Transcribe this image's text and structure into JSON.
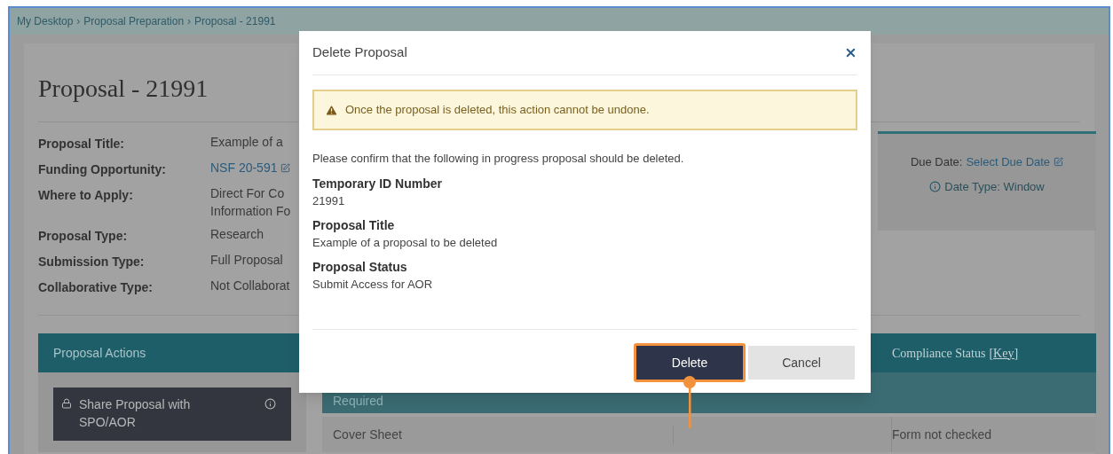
{
  "breadcrumb": {
    "separator": "›",
    "items": [
      "My Desktop",
      "Proposal Preparation",
      "Proposal - 21991"
    ]
  },
  "page_title": "Proposal - 21991",
  "details": [
    {
      "label": "Proposal Title:",
      "lines": [
        "Example of a"
      ],
      "kind": "text"
    },
    {
      "label": "Funding Opportunity:",
      "lines": [
        "NSF 20-591"
      ],
      "kind": "link"
    },
    {
      "label": "Where to Apply:",
      "lines": [
        "Direct For Co",
        "Information Fo"
      ],
      "kind": "text"
    },
    {
      "label": "Proposal Type:",
      "lines": [
        "Research"
      ],
      "kind": "text"
    },
    {
      "label": "Submission Type:",
      "lines": [
        "Full Proposal"
      ],
      "kind": "text"
    },
    {
      "label": "Collaborative Type:",
      "lines": [
        "Not Collaborat"
      ],
      "kind": "text"
    }
  ],
  "due_date": {
    "label": "Due Date:",
    "link": "Select Due Date",
    "date_type": "Date Type: Window"
  },
  "actions": {
    "title": "Proposal Actions",
    "buttons": [
      {
        "label": "Share Proposal with SPO/AOR",
        "locked": true
      }
    ]
  },
  "table": {
    "column_3": "Compliance Status",
    "key_link": "[Key]",
    "section": "Required",
    "rows": [
      {
        "name": "Cover Sheet",
        "compliance": "Form not checked"
      }
    ]
  },
  "modal": {
    "title": "Delete Proposal",
    "warning": "Once the proposal is deleted, this action cannot be undone.",
    "intro": "Please confirm that the following in progress proposal should be deleted.",
    "fields": [
      {
        "label": "Temporary ID Number",
        "value": "21991"
      },
      {
        "label": "Proposal Title",
        "value": "Example of a proposal to be deleted"
      },
      {
        "label": "Proposal Status",
        "value": "Submit Access for AOR"
      }
    ],
    "buttons": [
      {
        "label": "Delete",
        "kind": "primary",
        "highlighted": true
      },
      {
        "label": "Cancel",
        "kind": "secondary",
        "highlighted": false
      }
    ]
  }
}
